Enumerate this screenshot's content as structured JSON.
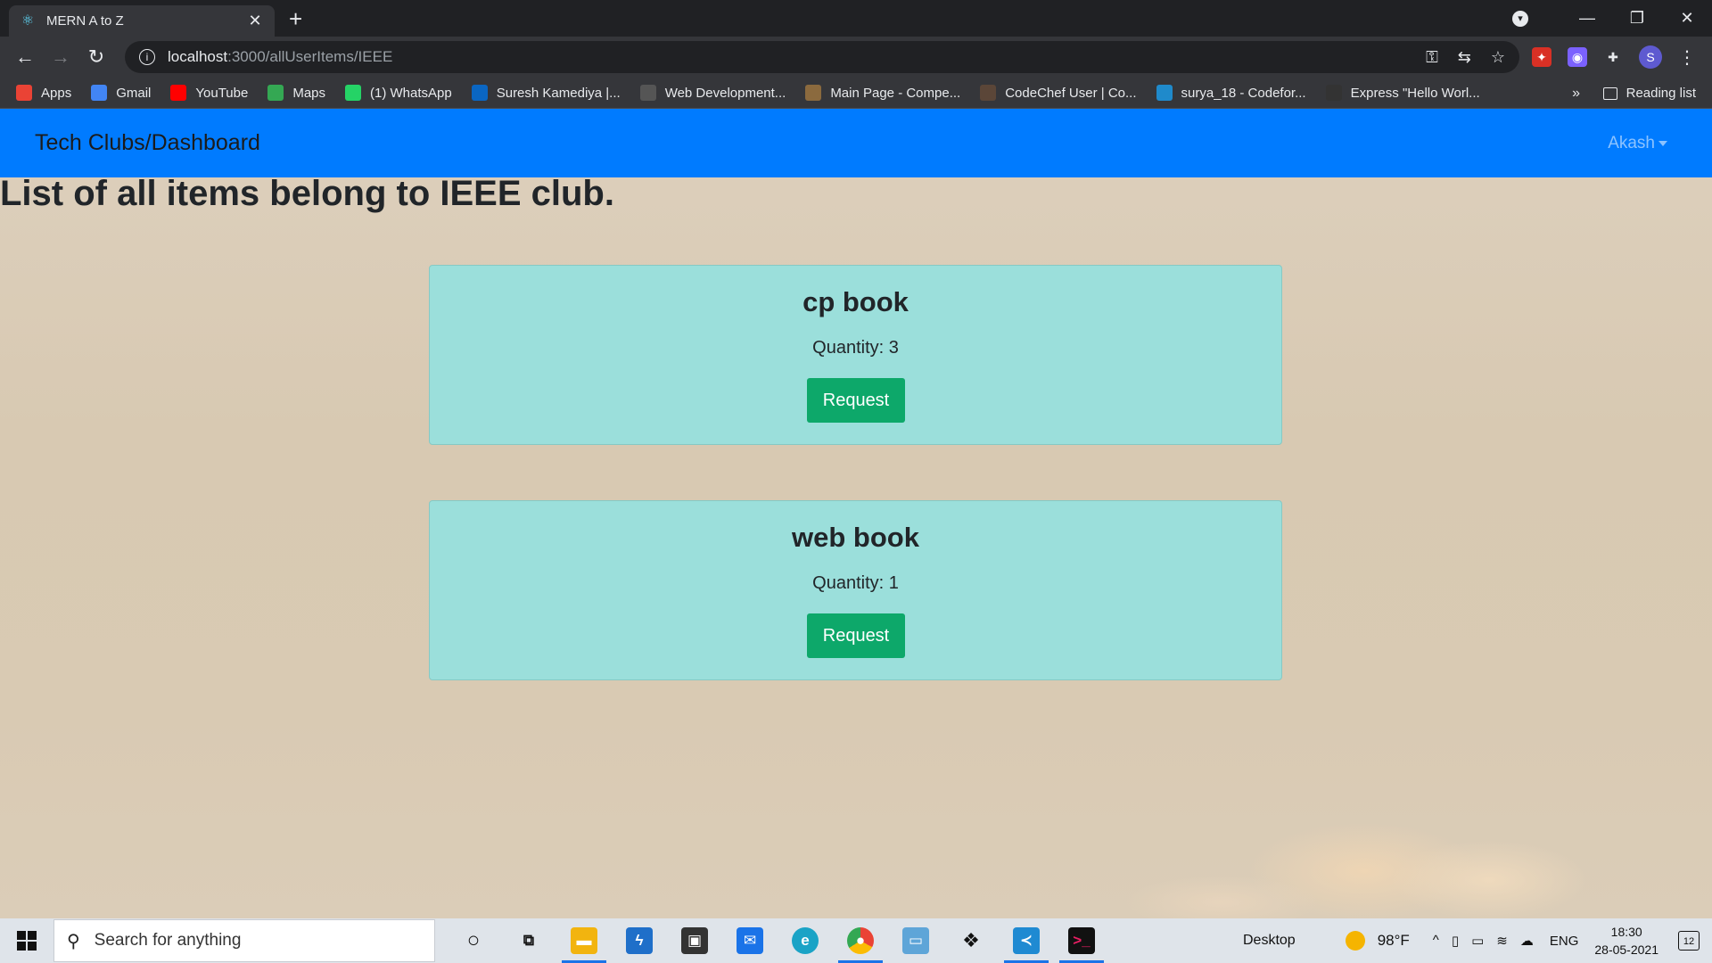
{
  "browser": {
    "tab_title": "MERN A to Z",
    "url_host": "localhost",
    "url_path": ":3000/allUserItems/IEEE",
    "bookmarks": [
      {
        "label": "Apps",
        "color": "#ea4335"
      },
      {
        "label": "Gmail",
        "color": "#4285f4"
      },
      {
        "label": "YouTube",
        "color": "#ff0000"
      },
      {
        "label": "Maps",
        "color": "#34a853"
      },
      {
        "label": "(1) WhatsApp",
        "color": "#25d366"
      },
      {
        "label": "Suresh Kamediya |...",
        "color": "#0a66c2"
      },
      {
        "label": "Web Development...",
        "color": "#555555"
      },
      {
        "label": "Main Page - Compe...",
        "color": "#8b6a3e"
      },
      {
        "label": "CodeChef User | Co...",
        "color": "#5b4638"
      },
      {
        "label": "surya_18 - Codefor...",
        "color": "#1f8acb"
      },
      {
        "label": "Express \"Hello Worl...",
        "color": "#333333"
      }
    ],
    "bookmarks_more": "»",
    "reading_list": "Reading list",
    "profile_initial": "S"
  },
  "app": {
    "brand": "Tech Clubs/Dashboard",
    "user_menu": "Akash",
    "page_title": "List of all items belong to IEEE club.",
    "items": [
      {
        "name": "cp book",
        "quantity": "Quantity: 3",
        "button": "Request"
      },
      {
        "name": "web book",
        "quantity": "Quantity: 1",
        "button": "Request"
      }
    ]
  },
  "taskbar": {
    "search_placeholder": "Search for anything",
    "desktop_label": "Desktop",
    "weather": "98°F",
    "language": "ENG",
    "time": "18:30",
    "date": "28-05-2021",
    "notification_count": "12"
  },
  "colors": {
    "navbar": "#007bff",
    "card": "#9bdfdb",
    "button": "#0da86a"
  }
}
